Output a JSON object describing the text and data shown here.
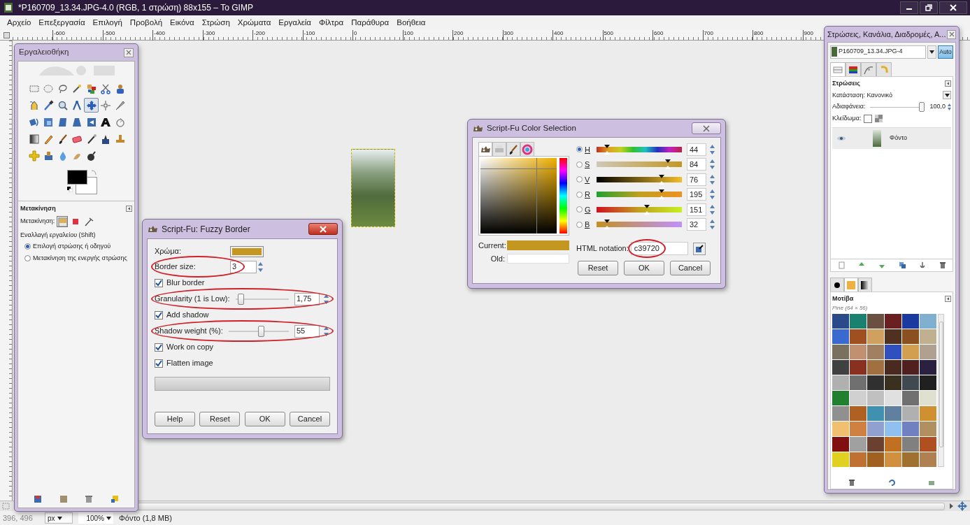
{
  "window": {
    "title": "*P160709_13.34.JPG-4.0 (RGB, 1 στρώση) 88x155 – Το GIMP"
  },
  "menu": [
    "Αρχείο",
    "Επεξεργασία",
    "Επιλογή",
    "Προβολή",
    "Εικόνα",
    "Στρώση",
    "Χρώματα",
    "Εργαλεία",
    "Φίλτρα",
    "Παράθυρα",
    "Βοήθεια"
  ],
  "ruler": [
    "-600",
    "-500",
    "-400",
    "-300",
    "-200",
    "-100",
    "0",
    "100",
    "200",
    "300",
    "400",
    "500",
    "600",
    "700",
    "800",
    "900"
  ],
  "toolbox": {
    "title": "Εργαλειοθήκη",
    "tools": [
      {
        "selected": false
      },
      {
        "selected": false
      },
      {
        "selected": false
      },
      {
        "selected": false
      },
      {
        "selected": false
      },
      {
        "selected": false
      },
      {
        "selected": false
      },
      {
        "selected": false
      },
      {
        "selected": false
      },
      {
        "selected": false
      },
      {
        "selected": false
      },
      {
        "selected": true
      },
      {
        "selected": false
      },
      {
        "selected": false
      },
      {
        "selected": false
      },
      {
        "selected": false
      },
      {
        "selected": false
      },
      {
        "selected": false
      },
      {
        "selected": false
      },
      {
        "selected": false
      },
      {
        "selected": false
      },
      {
        "selected": false
      },
      {
        "selected": false
      },
      {
        "selected": false
      },
      {
        "selected": false
      },
      {
        "selected": false
      },
      {
        "selected": false
      },
      {
        "selected": false
      },
      {
        "selected": false
      },
      {
        "selected": false
      },
      {
        "selected": false
      },
      {
        "selected": false
      },
      {
        "selected": false
      }
    ],
    "options": {
      "title": "Μετακίνηση",
      "move_label": "Μετακίνηση:",
      "mode_buttons": [
        {
          "selected": true
        },
        {
          "selected": false
        },
        {
          "selected": false
        }
      ],
      "toggle_label": "Εναλλαγή εργαλείου  (Shift)",
      "radios": [
        {
          "label": "Επιλογή στρώσης ή οδηγού",
          "selected": true
        },
        {
          "label": "Μετακίνηση της ενεργής στρώσης",
          "selected": false
        }
      ]
    }
  },
  "fuzzy_border": {
    "title": "Script-Fu: Fuzzy Border",
    "color_label": "Χρώμα:",
    "fields": [
      {
        "kind": "spin",
        "label": "Border size:",
        "value": "3",
        "circled": true
      },
      {
        "kind": "check",
        "label": "Blur border",
        "checked": true
      },
      {
        "kind": "slider",
        "label": "Granularity (1 is Low):",
        "level": 0.05,
        "value": "1,75",
        "circled": true
      },
      {
        "kind": "check",
        "label": "Add shadow",
        "checked": true
      },
      {
        "kind": "slider",
        "label": "Shadow weight (%):",
        "level": 0.55,
        "value": "55",
        "circled": true
      },
      {
        "kind": "check",
        "label": "Work on copy",
        "checked": true
      },
      {
        "kind": "check",
        "label": "Flatten image",
        "checked": true
      }
    ],
    "progress": {
      "level": 0
    },
    "buttons": [
      "Help",
      "Reset",
      "OK",
      "Cancel"
    ]
  },
  "color_selection": {
    "title": "Script-Fu Color Selection",
    "tabs": [
      {
        "selected": true
      },
      {
        "selected": false
      },
      {
        "selected": false
      },
      {
        "selected": false
      }
    ],
    "current_label": "Current:",
    "old_label": "Old:",
    "channels": [
      {
        "label": "H",
        "selected": true,
        "level": 0.122,
        "value": "44"
      },
      {
        "label": "S",
        "selected": false,
        "level": 0.84,
        "value": "84"
      },
      {
        "label": "V",
        "selected": false,
        "level": 0.76,
        "value": "76"
      },
      {
        "label": "R",
        "selected": false,
        "level": 0.765,
        "value": "195"
      },
      {
        "label": "G",
        "selected": false,
        "level": 0.592,
        "value": "151"
      },
      {
        "label": "B",
        "selected": false,
        "level": 0.125,
        "value": "32"
      }
    ],
    "html_label": "HTML notation:",
    "html_value": "c39720",
    "html_circled": true,
    "buttons": [
      "Reset",
      "OK",
      "Cancel"
    ]
  },
  "dock": {
    "title": "Στρώσεις, Κανάλια, Διαδρομές, Α...",
    "image": "P160709_13.34.JPG-4",
    "auto": "Auto",
    "tabs": [
      {
        "selected": true
      },
      {
        "selected": false
      },
      {
        "selected": false
      },
      {
        "selected": false
      }
    ],
    "layers_title": "Στρώσεις",
    "mode": "Κατάσταση: Κανονικό",
    "opacity_label": "Αδιαφάνεια:",
    "opacity_slider": {
      "level": 1
    },
    "opacity_value": "100,0",
    "lock_label": "Κλείδωμα:",
    "lock_checked": false,
    "layers": [
      {
        "name": "Φόντο",
        "visible": true,
        "selected": true
      }
    ],
    "bottom_tabs": [
      {
        "selected": false
      },
      {
        "selected": true
      },
      {
        "selected": false
      }
    ],
    "patterns_title": "Μοτίβα",
    "pattern_name": "Pine (64 × 56)"
  },
  "status_bar": {
    "coords": "396, 496",
    "unit": "px",
    "zoom": "100%",
    "info": "Φόντο (1,8 MB)"
  }
}
